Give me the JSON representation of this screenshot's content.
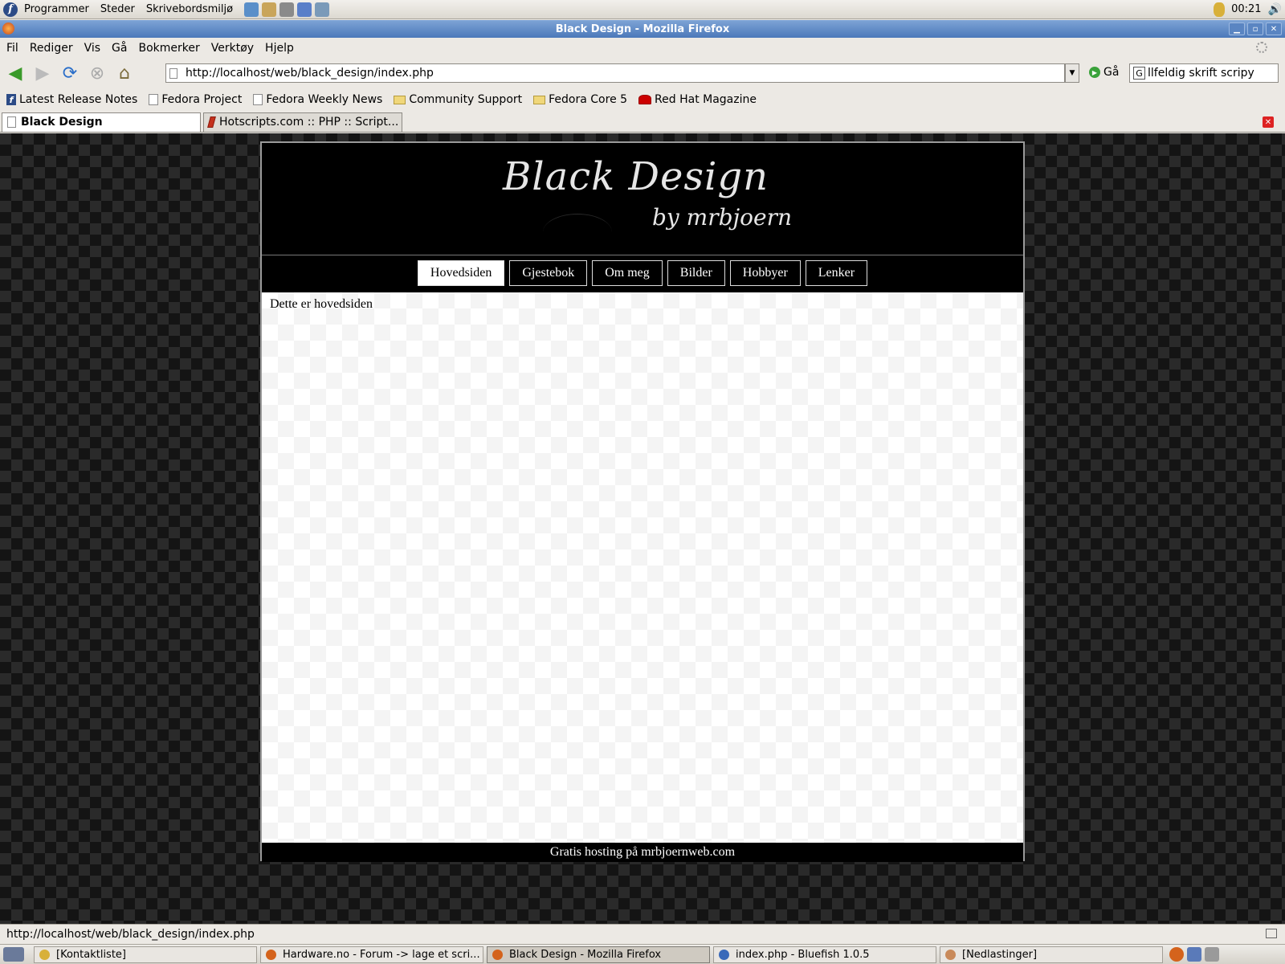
{
  "top_panel": {
    "menus": [
      "Programmer",
      "Steder",
      "Skrivebordsmiljø"
    ],
    "clock": "00:21"
  },
  "window": {
    "title": "Black Design - Mozilla Firefox"
  },
  "menu_bar": [
    "Fil",
    "Rediger",
    "Vis",
    "Gå",
    "Bokmerker",
    "Verktøy",
    "Hjelp"
  ],
  "nav_bar": {
    "url": "http://localhost/web/black_design/index.php",
    "go_label": "Gå",
    "search_value": "llfeldig skrift scripy"
  },
  "bookmarks": [
    {
      "label": "Latest Release Notes",
      "icon": "fedora-icon"
    },
    {
      "label": "Fedora Project",
      "icon": "page-icon"
    },
    {
      "label": "Fedora Weekly News",
      "icon": "page-icon"
    },
    {
      "label": "Community Support",
      "icon": "folder-icon"
    },
    {
      "label": "Fedora Core 5",
      "icon": "folder-icon"
    },
    {
      "label": "Red Hat Magazine",
      "icon": "redhat-icon"
    }
  ],
  "tabs": [
    {
      "label": "Black Design",
      "active": true
    },
    {
      "label": "Hotscripts.com :: PHP :: Script...",
      "active": false
    }
  ],
  "site": {
    "title": "Black Design",
    "subtitle": "by mrbjoern",
    "nav": [
      "Hovedsiden",
      "Gjestebok",
      "Om meg",
      "Bilder",
      "Hobbyer",
      "Lenker"
    ],
    "active_nav": "Hovedsiden",
    "body_text": "Dette er hovedsiden",
    "footer": "Gratis hosting på mrbjoernweb.com"
  },
  "status_bar": {
    "text": "http://localhost/web/black_design/index.php"
  },
  "taskbar": [
    {
      "label": "[Kontaktliste]",
      "active": false
    },
    {
      "label": "Hardware.no - Forum -> lage et scri...",
      "active": false
    },
    {
      "label": "Black Design - Mozilla Firefox",
      "active": true
    },
    {
      "label": "index.php - Bluefish 1.0.5",
      "active": false
    },
    {
      "label": "[Nedlastinger]",
      "active": false
    }
  ],
  "colors": {
    "title_bar": "#4b78b9",
    "site_bg": "#000000",
    "site_body": "#ffffff"
  }
}
